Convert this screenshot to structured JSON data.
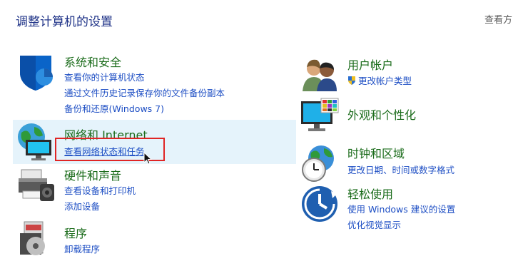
{
  "header": {
    "title": "调整计算机的设置",
    "view_by": "查看方"
  },
  "left_categories": [
    {
      "title": "系统和安全",
      "icon": "security-shield-icon",
      "links": [
        "查看你的计算机状态",
        "通过文件历史记录保存你的文件备份副本",
        "备份和还原(Windows 7)"
      ]
    },
    {
      "title": "网络和 Internet",
      "icon": "network-globe-icon",
      "links": [
        "查看网络状态和任务"
      ]
    },
    {
      "title": "硬件和声音",
      "icon": "printer-icon",
      "links": [
        "查看设备和打印机",
        "添加设备"
      ]
    },
    {
      "title": "程序",
      "icon": "programs-disc-icon",
      "links": [
        "卸载程序"
      ]
    }
  ],
  "right_categories": [
    {
      "title": "用户帐户",
      "icon": "users-icon",
      "links": [
        "更改帐户类型"
      ]
    },
    {
      "title": "外观和个性化",
      "icon": "monitor-palette-icon",
      "links": []
    },
    {
      "title": "时钟和区域",
      "icon": "clock-globe-icon",
      "links": [
        "更改日期、时间或数字格式"
      ]
    },
    {
      "title": "轻松使用",
      "icon": "ease-of-access-icon",
      "links": [
        "使用 Windows 建议的设置",
        "优化视觉显示"
      ]
    }
  ],
  "colors": {
    "title_blue": "#1e3287",
    "category_green": "#1a6b1a",
    "link_blue": "#1d4ec4",
    "hover_bg": "#e5f3fb",
    "highlight_red": "#e02525"
  }
}
